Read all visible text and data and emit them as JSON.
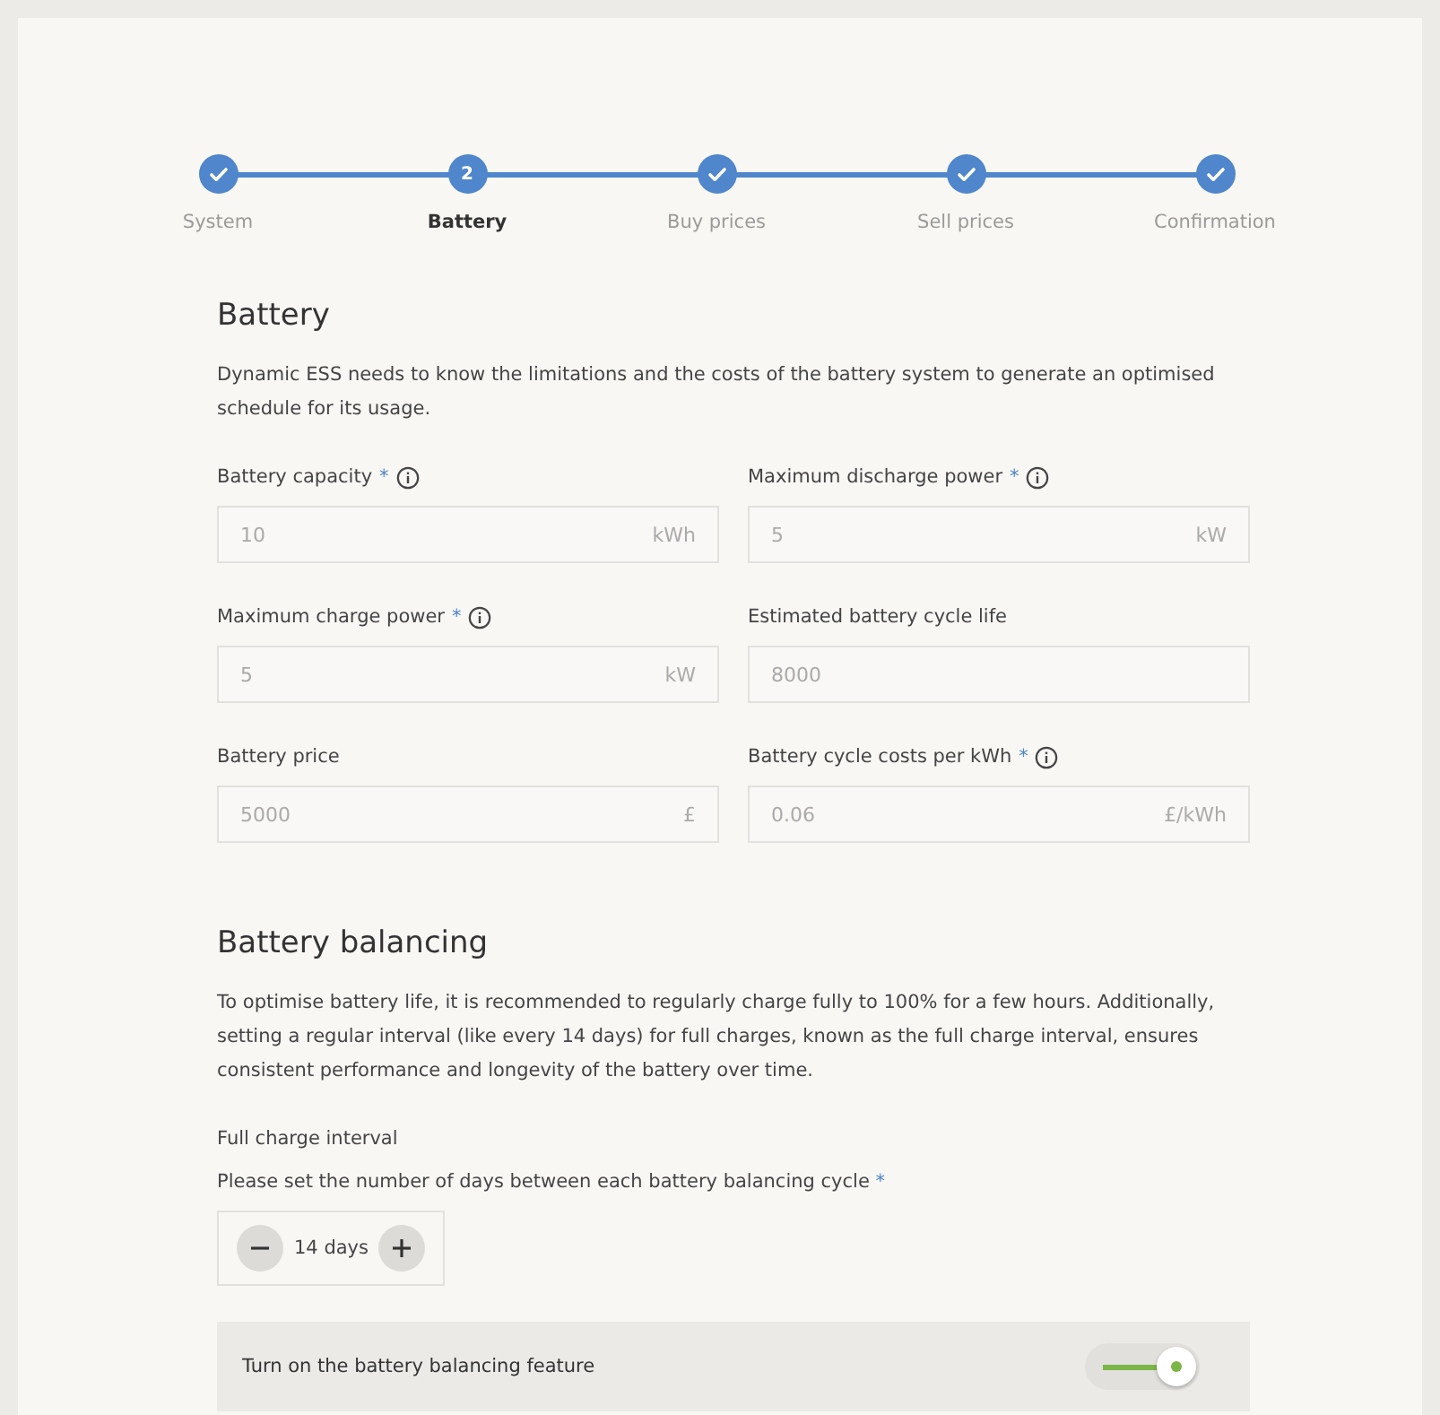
{
  "stepper": [
    {
      "label": "System",
      "kind": "done",
      "selected": false
    },
    {
      "label": "Battery",
      "kind": "number",
      "number": "2",
      "selected": true
    },
    {
      "label": "Buy prices",
      "kind": "done",
      "selected": false
    },
    {
      "label": "Sell prices",
      "kind": "done",
      "selected": false
    },
    {
      "label": "Confirmation",
      "kind": "done",
      "selected": false
    }
  ],
  "battery": {
    "title": "Battery",
    "description": "Dynamic ESS needs to know the limitations and the costs of the battery system to generate an optimised schedule for its usage.",
    "fields": [
      {
        "label": "Battery capacity",
        "required_mark": "*",
        "info": true,
        "value": "10",
        "unit": "kWh"
      },
      {
        "label": "Maximum discharge power",
        "required_mark": "*",
        "info": true,
        "value": "5",
        "unit": "kW"
      },
      {
        "label": "Maximum charge power",
        "required_mark": "*",
        "info": true,
        "value": "5",
        "unit": "kW"
      },
      {
        "label": "Estimated battery cycle life",
        "value": "8000"
      },
      {
        "label": "Battery price",
        "value": "5000",
        "unit": "£"
      },
      {
        "label": "Battery cycle costs per kWh",
        "required_mark": "*",
        "info": true,
        "value": "0.06",
        "unit": "£/kWh"
      }
    ]
  },
  "balancing": {
    "title": "Battery balancing",
    "description": "To optimise battery life, it is recommended to regularly charge fully to 100% for a few hours. Additionally, setting a regular interval (like every 14 days) for full charges, known as the full charge interval, ensures consistent performance and longevity of the battery over time.",
    "interval_title": "Full charge interval",
    "interval_prompt": "Please set the number of days between each battery balancing cycle",
    "interval_required_mark": "*",
    "interval_value": "14 days",
    "toggle": {
      "label": "Turn on the battery balancing feature",
      "on": true
    }
  }
}
